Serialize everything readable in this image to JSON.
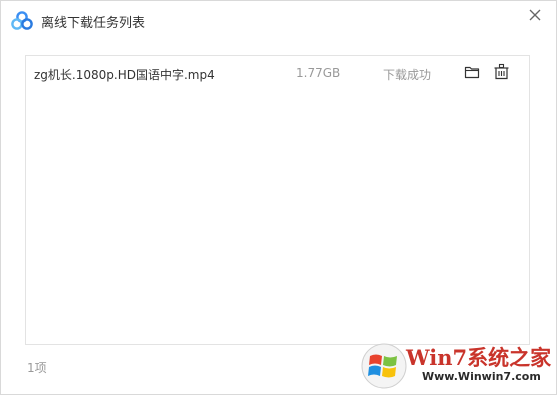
{
  "window": {
    "title": "离线下载任务列表"
  },
  "tasks": [
    {
      "name": "zg机长.1080p.HD国语中字.mp4",
      "size": "1.77GB",
      "status": "下载成功"
    }
  ],
  "footer": {
    "count_label": "1项"
  },
  "watermark": {
    "brand": "Win7系统之家",
    "url": "Www.Winwin7.com"
  },
  "colors": {
    "title_text": "#333333",
    "muted_text": "#999999",
    "border": "#e3e3e3",
    "watermark_red": "#c9342b",
    "logo_blue": "#3b8ff3"
  },
  "icons": {
    "app_logo": "baidu-netdisk-logo",
    "close": "close-icon",
    "folder": "folder-icon",
    "delete": "trash-icon"
  }
}
